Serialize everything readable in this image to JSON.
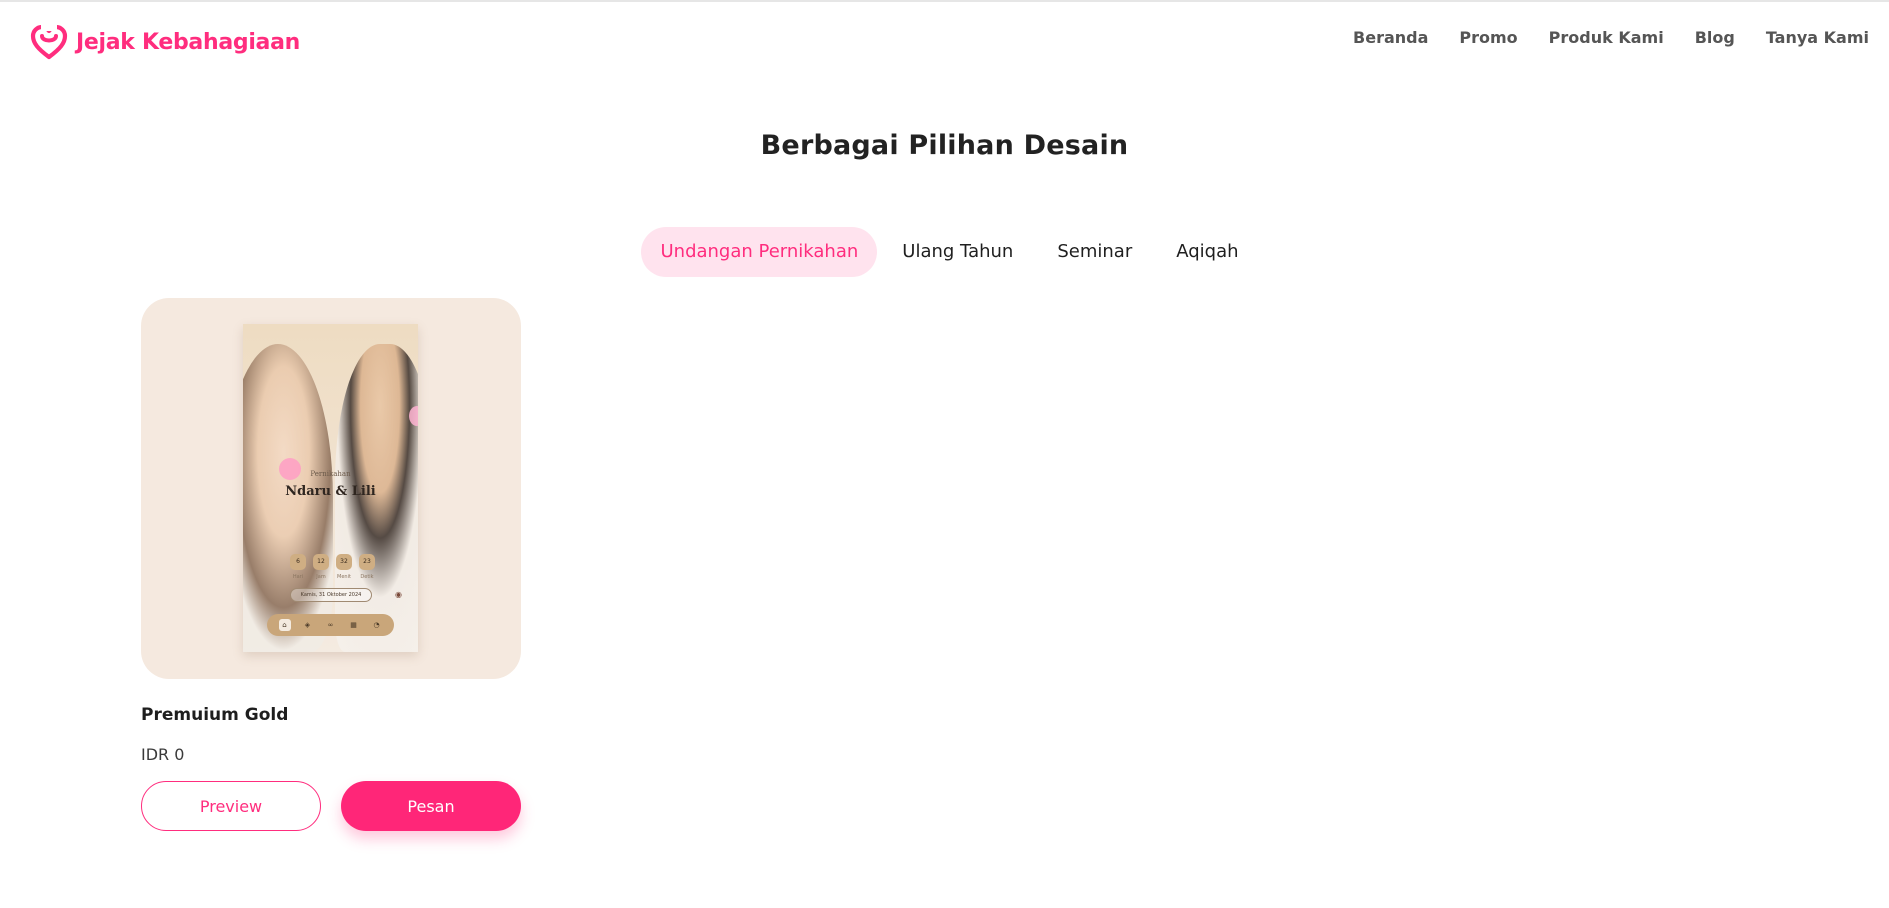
{
  "brand": {
    "name": "Jejak Kebahagiaan",
    "icon": "heart-logo-icon",
    "color": "#ff2d7e"
  },
  "nav": {
    "items": [
      {
        "label": "Beranda"
      },
      {
        "label": "Promo"
      },
      {
        "label": "Produk Kami"
      },
      {
        "label": "Blog"
      },
      {
        "label": "Tanya Kami"
      }
    ]
  },
  "section": {
    "title": "Berbagai Pilihan Desain"
  },
  "tabs": {
    "active_index": 0,
    "items": [
      {
        "label": "Undangan Pernikahan"
      },
      {
        "label": "Ulang Tahun"
      },
      {
        "label": "Seminar"
      },
      {
        "label": "Aqiqah"
      }
    ]
  },
  "products": [
    {
      "name": "Premuium Gold",
      "price": "IDR 0",
      "preview_label": "Preview",
      "order_label": "Pesan",
      "thumbnail": {
        "subtitle": "Pernikahan",
        "names": "Ndaru & Lili",
        "countdown": [
          {
            "value": "6",
            "label": "Hari"
          },
          {
            "value": "12",
            "label": "Jam"
          },
          {
            "value": "32",
            "label": "Menit"
          },
          {
            "value": "23",
            "label": "Detik"
          }
        ],
        "date": "Kamis, 31 Oktober 2024"
      }
    }
  ],
  "colors": {
    "accent": "#ff2d7e",
    "tab_active_bg": "#ffe3ee",
    "card_bg": "#f5e9df"
  }
}
